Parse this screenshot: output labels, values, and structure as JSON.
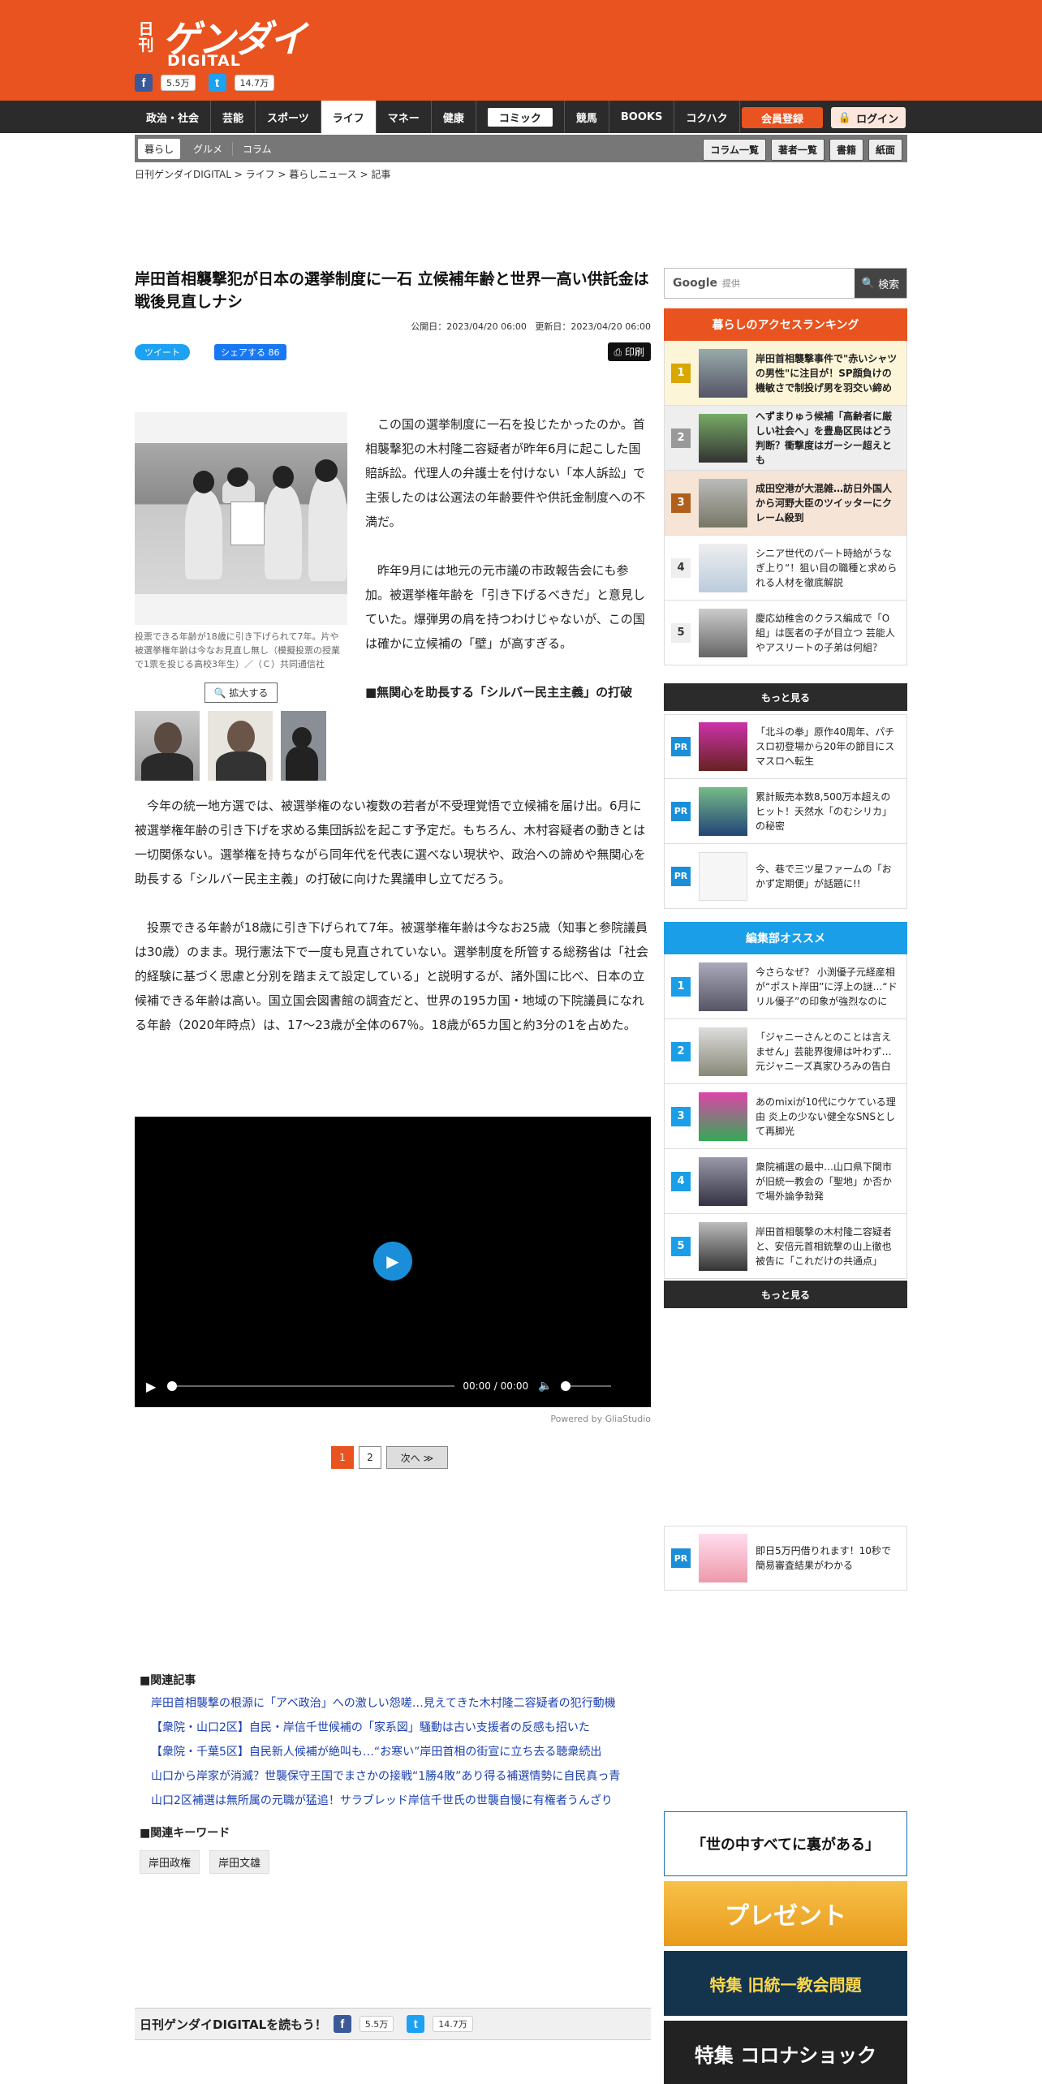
{
  "logo": {
    "nikkan": "日刊",
    "main": "ゲンダイ",
    "sub": "DIGITAL"
  },
  "social": {
    "fb_count": "5.5万",
    "tw_count": "14.7万"
  },
  "nav": {
    "items": [
      "政治・社会",
      "芸能",
      "スポーツ",
      "ライフ",
      "マネー",
      "健康",
      "コミック",
      "競馬",
      "BOOKS",
      "コクハク"
    ],
    "register": "会員登録",
    "login": "ログイン"
  },
  "subnav": {
    "items": [
      "暮らし",
      "グルメ",
      "コラム"
    ],
    "right": [
      "コラム一覧",
      "著者一覧",
      "書籍",
      "紙面"
    ]
  },
  "breadcrumb": "日刊ゲンダイDIGITAL > ライフ > 暮らしニュース > 記事",
  "article": {
    "title": "岸田首相襲撃犯が日本の選挙制度に一石 立候補年齢と世界一高い供託金は戦後見直しナシ",
    "published": "公開日：2023/04/20 06:00",
    "updated": "更新日：2023/04/20 06:00",
    "tweet": "ツイート",
    "fb_share": "シェアする 86",
    "print": "印刷",
    "caption": "投票できる年齢が18歳に引き下げられて7年。片や被選挙権年齢は今なお見直し無し（模擬投票の授業で1票を投じる高校3年生）／（Ｃ）共同通信社",
    "zoom": "拡大する",
    "p1": "この国の選挙制度に一石を投じたかったのか。首相襲撃犯の木村隆二容疑者が昨年6月に起こした国賠訴訟。代理人の弁護士を付けない「本人訴訟」で主張したのは公選法の年齢要件や供託金制度への不満だ。",
    "p2": "昨年9月には地元の元市議の市政報告会にも参加。被選挙権年齢を「引き下げるべきだ」と意見していた。爆弾男の肩を持つわけじゃないが、この国は確かに立候補の「壁」が高すぎる。",
    "h3": "■無関心を助長する「シルバー民主主義」の打破",
    "p3": "今年の統一地方選では、被選挙権のない複数の若者が不受理覚悟で立候補を届け出。6月に被選挙権年齢の引き下げを求める集団訴訟を起こす予定だ。もちろん、木村容疑者の動きとは一切関係ない。選挙権を持ちながら同年代を代表に選べない現状や、政治への諦めや無関心を助長する「シルバー民主主義」の打破に向けた異議申し立てだろう。",
    "p4": "投票できる年齢が18歳に引き下げられて7年。被選挙権年齢は今なお25歳（知事と参院議員は30歳）のまま。現行憲法下で一度も見直されていない。選挙制度を所管する総務省は「社会的経験に基づく思慮と分別を踏まえて設定している」と説明するが、諸外国に比べ、日本の立候補できる年齢は高い。国立国会図書館の調査だと、世界の195カ国・地域の下院議員になれる年齢（2020年時点）は、17～23歳が全体の67％。18歳が65カ国と約3分の1を占めた。"
  },
  "video": {
    "time": "00:00 / 00:00",
    "powered": "Powered by GliaStudio"
  },
  "pager": {
    "p1": "1",
    "p2": "2",
    "next": "次へ ≫"
  },
  "related": {
    "heading": "■関連記事",
    "links": [
      "岸田首相襲撃の根源に「アベ政治」への激しい怨嗟…見えてきた木村隆二容疑者の犯行動機",
      "【衆院・山口2区】自民・岸信千世候補の「家系図」騒動は古い支援者の反感も招いた",
      "【衆院・千葉5区】自民新人候補が絶叫も…“お寒い”岸田首相の街宣に立ち去る聴衆続出",
      "山口から岸家が消滅？世襲保守王国でまさかの接戦“1勝4敗”あり得る補選情勢に自民真っ青",
      "山口2区補選は無所属の元職が猛追！サラブレッド岸信千世氏の世襲自慢に有権者うんざり"
    ],
    "kw_heading": "■関連キーワード",
    "keywords": [
      "岸田政権",
      "岸田文雄"
    ]
  },
  "readbar": {
    "label": "日刊ゲンダイDIGITALを読もう！",
    "fb": "5.5万",
    "tw": "14.7万"
  },
  "sidebar": {
    "search_placeholder": "提供",
    "google": "Google",
    "search_btn": "検索",
    "ranking_title": "暮らしのアクセスランキング",
    "ranking": [
      {
        "n": "1",
        "t": "岸田首相襲撃事件で\"赤いシャツの男性\"に注目が！SP顔負けの機敏さで制投げ男を羽交い締め"
      },
      {
        "n": "2",
        "t": "へずまりゅう候補「高齢者に厳しい社会へ」を豊島区民はどう判断？衝撃度はガーシー超えとも"
      },
      {
        "n": "3",
        "t": "成田空港が大混雑…訪日外国人から河野大臣のツイッターにクレーム殺到"
      },
      {
        "n": "4",
        "t": "シニア世代のパート時給がうなぎ上り“！狙い目の職種と求められる人材を徹底解説"
      },
      {
        "n": "5",
        "t": "慶応幼稚舎のクラス編成で「O組」は医者の子が目立つ 芸能人やアスリートの子弟は何組？"
      }
    ],
    "more": "もっと見る",
    "pr": [
      {
        "t": "「北斗の拳」原作40周年、パチスロ初登場から20年の節目にスマスロへ転生"
      },
      {
        "t": "累計販売本数8,500万本超えのヒット！天然水「のむシリカ」の秘密"
      },
      {
        "t": "今、巷で三ツ星ファームの「おかず定期便」が話題に!!"
      }
    ],
    "pr_label": "PR",
    "editor_title": "編集部オススメ",
    "editor": [
      {
        "n": "1",
        "t": "今さらなぜ？ 小渕優子元経産相が“ポスト岸田”に浮上の謎…“ドリル優子”の印象が強烈なのに"
      },
      {
        "n": "2",
        "t": "「ジャニーさんとのことは言えません」芸能界復帰は叶わず…元ジャニーズ真家ひろみの告白"
      },
      {
        "n": "3",
        "t": "あのmixiが10代にウケている理由 炎上の少ない健全なSNSとして再脚光"
      },
      {
        "n": "4",
        "t": "衆院補選の最中…山口県下関市が旧統一教会の「聖地」か否かで場外論争勃発"
      },
      {
        "n": "5",
        "t": "岸田首相襲撃の木村隆二容疑者と、安倍元首相銃撃の山上徹也被告に「これだけの共通点」"
      }
    ],
    "pr_bottom": "即日5万円借りれます！10秒で簡易審査結果がわかる",
    "banners": [
      "「世の中すべてに裏がある」",
      "プレゼント",
      "特集 旧統一教会問題",
      "特集 コロナショック"
    ]
  }
}
